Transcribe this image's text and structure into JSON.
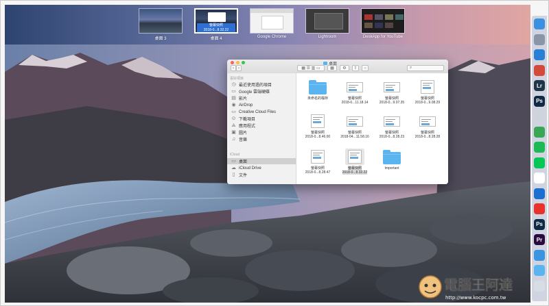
{
  "mission_control": {
    "spaces": [
      {
        "label": "桌面 3",
        "active": false
      },
      {
        "label": "桌面 4",
        "active": true,
        "overlay_title": "螢幕快照",
        "overlay_date": "2018-0...8.32.22"
      },
      {
        "label": "Google Chrome",
        "active": false
      },
      {
        "label": "Lightroom",
        "active": false
      },
      {
        "label": "DeskApp for YouTube",
        "active": false
      }
    ]
  },
  "finder": {
    "window_title": "桌面",
    "sidebar": {
      "favorites_header": "喜好項目",
      "favorites": [
        {
          "label": "最近使用過的項目",
          "icon": "clock-icon"
        },
        {
          "label": "Google 雲端硬碟",
          "icon": "drive-icon"
        },
        {
          "label": "影片",
          "icon": "film-icon"
        },
        {
          "label": "AirDrop",
          "icon": "airdrop-icon"
        },
        {
          "label": "Creative Cloud Files",
          "icon": "creative-cloud-icon"
        },
        {
          "label": "下載項目",
          "icon": "download-icon"
        },
        {
          "label": "應用程式",
          "icon": "applications-icon"
        },
        {
          "label": "圖片",
          "icon": "picture-icon"
        },
        {
          "label": "音樂",
          "icon": "music-icon"
        }
      ],
      "icloud_header": "iCloud",
      "icloud": [
        {
          "label": "桌面",
          "icon": "desktop-icon",
          "selected": true
        },
        {
          "label": "iCloud Drive",
          "icon": "cloud-icon"
        },
        {
          "label": "文件",
          "icon": "document-icon"
        }
      ]
    },
    "files": [
      {
        "type": "folder",
        "name": "未命名的檔存",
        "date": ""
      },
      {
        "type": "shot",
        "name": "螢幕快照",
        "date": "2018-0...11.18.14"
      },
      {
        "type": "shot",
        "name": "螢幕快照",
        "date": "2018-0...9.07.35"
      },
      {
        "type": "shot",
        "name": "螢幕快照",
        "date": "2018-0...9.08.29"
      },
      {
        "type": "shot",
        "name": "螢幕快照",
        "date": "2018-0...8.46.00"
      },
      {
        "type": "shot",
        "name": "螢幕快照",
        "date": "2018-04...11.58.16"
      },
      {
        "type": "shot",
        "name": "螢幕快照",
        "date": "2018-0...8.28.23"
      },
      {
        "type": "shot",
        "name": "螢幕快照",
        "date": "2018-0...8.28.28"
      },
      {
        "type": "shot",
        "name": "螢幕快照",
        "date": "2018-0...8.28.47"
      },
      {
        "type": "shot",
        "name": "螢幕快照",
        "date": "2018-0...8.32.22",
        "selected": true
      },
      {
        "type": "folder",
        "name": "Important",
        "date": ""
      }
    ]
  },
  "dock": {
    "items": [
      {
        "name": "finder-icon",
        "text": "",
        "color": "#3d8fe0"
      },
      {
        "name": "launchpad-icon",
        "text": "",
        "color": "#8a96a8"
      },
      {
        "name": "safari-icon",
        "text": "",
        "color": "#2a7fd4"
      },
      {
        "name": "chrome-icon",
        "text": "",
        "color": "#d34a3a"
      },
      {
        "name": "lightroom-icon",
        "text": "Lr",
        "color": "#1f3548"
      },
      {
        "name": "photoshop-icon",
        "text": "Ps",
        "color": "#0f2a44"
      },
      {
        "name": "rocket-icon",
        "text": "",
        "color": "#cfd3da"
      },
      {
        "name": "chrome-2-icon",
        "text": "",
        "color": "#3aa757"
      },
      {
        "name": "spotify-icon",
        "text": "",
        "color": "#1db954"
      },
      {
        "name": "line-icon",
        "text": "",
        "color": "#06c755"
      },
      {
        "name": "clock-app-icon",
        "text": "",
        "color": "#ffffff"
      },
      {
        "name": "teamviewer-icon",
        "text": "",
        "color": "#1b6fd0"
      },
      {
        "name": "youtube-icon",
        "text": "",
        "color": "#e8322d"
      },
      {
        "name": "ps-icon-2",
        "text": "Ps",
        "color": "#0f2a44"
      },
      {
        "name": "premiere-icon",
        "text": "Pr",
        "color": "#2a0b3d"
      },
      {
        "name": "network-icon",
        "text": "",
        "color": "#3a94e0"
      },
      {
        "name": "folder-icon",
        "text": "",
        "color": "#5ab4f0"
      },
      {
        "name": "trash-icon",
        "text": "",
        "color": "#d8dde4"
      }
    ]
  },
  "watermark": {
    "title": "電腦王阿達",
    "url": "http://www.kocpc.com.tw"
  }
}
